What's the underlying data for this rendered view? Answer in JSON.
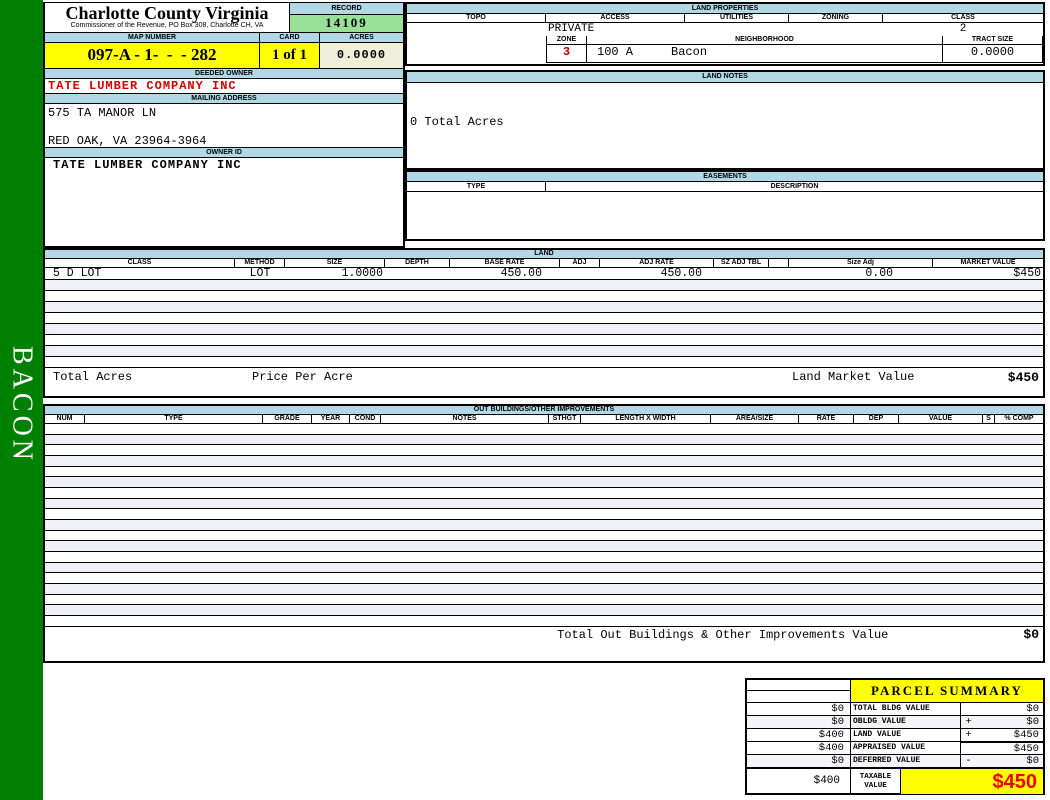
{
  "sidebar": {
    "label": "BACON"
  },
  "county": {
    "name": "Charlotte County Virginia",
    "commissioner": "Commissioner of the Revenue, PO Box 308, Charlotte CH, VA"
  },
  "record": {
    "label": "RECORD",
    "value": "14109"
  },
  "map": {
    "label": "MAP NUMBER",
    "value": "097-A - 1-  -  - 282"
  },
  "card": {
    "label": "CARD",
    "value": "1 of 1"
  },
  "acres": {
    "label": "ACRES",
    "value": "0.0000"
  },
  "deeded_owner": {
    "label": "DEEDED OWNER",
    "value": "TATE LUMBER COMPANY INC"
  },
  "mailing": {
    "label": "MAILING ADDRESS",
    "address": "575 TA MANOR LN\n\nRED OAK, VA 23964-3964"
  },
  "owner_id": {
    "label": "OWNER ID",
    "value": "TATE LUMBER COMPANY INC"
  },
  "land_properties": {
    "title": "LAND PROPERTIES",
    "topo_label": "TOPO",
    "access_label": "ACCESS",
    "utilities_label": "UTILITIES",
    "zoning_label": "ZONING",
    "class_label": "CLASS",
    "access_value": "PRIVATE",
    "class_value": "2",
    "zone_label": "ZONE",
    "zone_value": "3",
    "neighborhood_label": "NEIGHBORHOOD",
    "neighborhood_code": "100 A",
    "neighborhood_name": "Bacon",
    "tract_label": "TRACT SIZE",
    "tract_value": "0.0000"
  },
  "land_notes": {
    "title": "LAND NOTES",
    "note": "0 Total Acres"
  },
  "easements": {
    "title": "EASEMENTS",
    "type_label": "TYPE",
    "description_label": "DESCRIPTION"
  },
  "land": {
    "title": "LAND",
    "columns": [
      "CLASS",
      "METHOD",
      "SIZE",
      "DEPTH",
      "BASE RATE",
      "ADJ",
      "ADJ RATE",
      "SZ ADJ TBL",
      "",
      "Size Adj",
      "MARKET VALUE"
    ],
    "row_cells": [
      "5 D LOT",
      "LOT",
      "1.0000",
      "",
      "450.00",
      "",
      "450.00",
      "",
      "",
      "0.00",
      "$450"
    ],
    "total_acres_label": "Total Acres",
    "price_per_acre_label": "Price Per Acre",
    "market_value_label": "Land Market Value",
    "market_value_total": "$450"
  },
  "out_buildings": {
    "title": "OUT BUILDINGS/OTHER IMPROVEMENTS",
    "columns": [
      "NUM",
      "TYPE",
      "GRADE",
      "YEAR",
      "COND",
      "NOTES",
      "STHGT",
      "LENGTH X WIDTH",
      "AREA/SIZE",
      "RATE",
      "DEP",
      "VALUE",
      "S",
      "% COMP"
    ],
    "total_label": "Total Out Buildings & Other Improvements Value",
    "total_value": "$0"
  },
  "parcel_summary": {
    "title": "PARCEL SUMMARY",
    "rows": [
      {
        "left": "$0",
        "label": "TOTAL BLDG VALUE",
        "op": "",
        "right": "$0"
      },
      {
        "left": "$0",
        "label": "OBLDG VALUE",
        "op": "+",
        "right": "$0"
      },
      {
        "left": "$400",
        "label": "LAND VALUE",
        "op": "+",
        "right": "$450"
      },
      {
        "left": "$400",
        "label": "APPRAISED VALUE",
        "op": "",
        "right": "$450"
      },
      {
        "left": "$0",
        "label": "DEFERRED VALUE",
        "op": "-",
        "right": "$0"
      }
    ],
    "taxable": {
      "left": "$400",
      "label": "TAXABLE VALUE",
      "value": "$450"
    }
  },
  "colors": {
    "band_green": "#008000",
    "header_blue": "#b2d8e6",
    "highlight_yellow": "#ffff00",
    "record_green": "#99e199",
    "acres_cream": "#f0f0da",
    "owner_red": "#d40000",
    "taxable_red": "#ee0000",
    "row_stripe": "#f0f0f8"
  }
}
